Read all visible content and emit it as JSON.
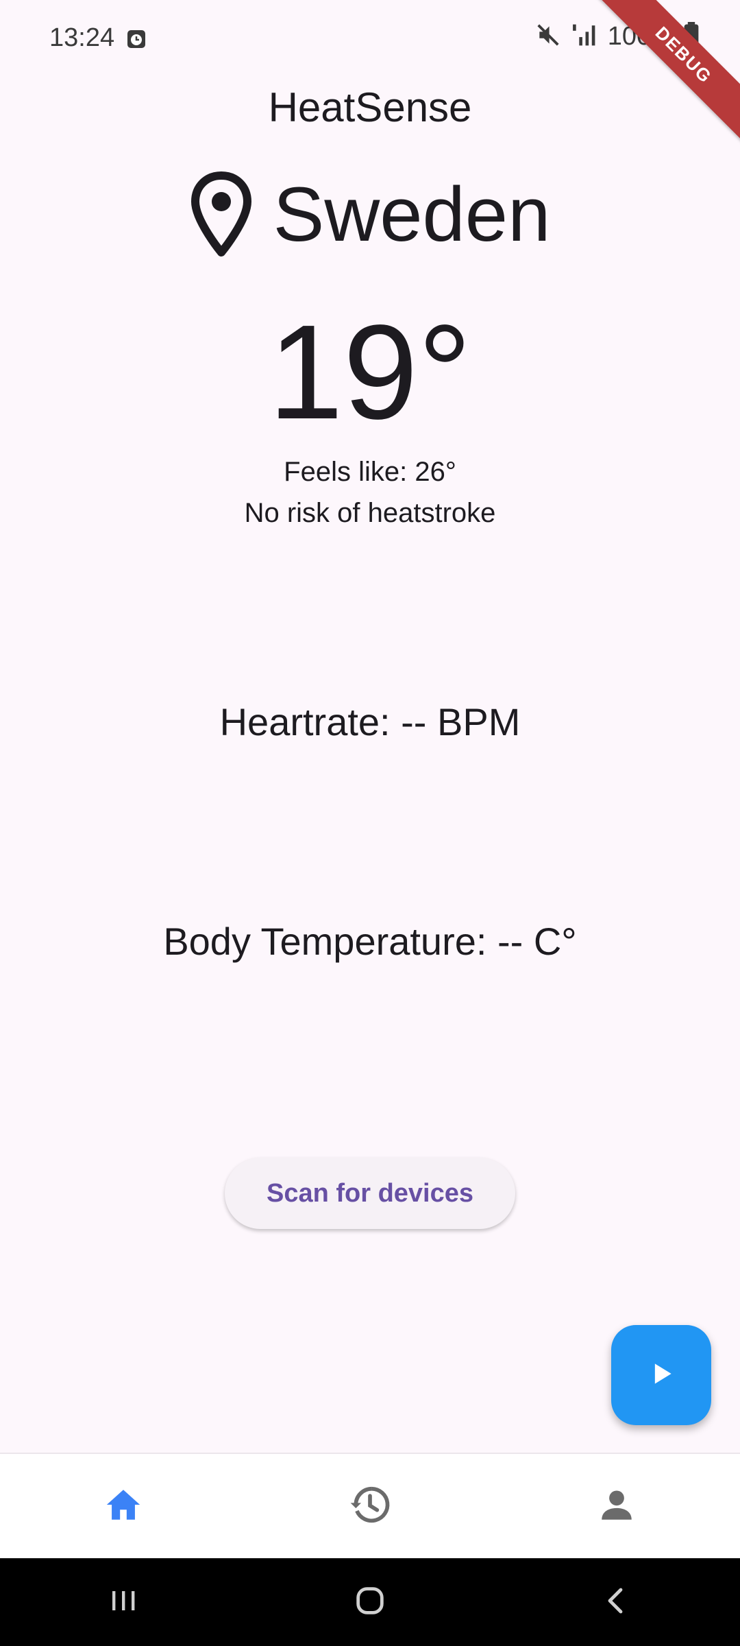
{
  "status_bar": {
    "time": "13:24",
    "battery": "100%",
    "icons": [
      "alarm-icon",
      "mute-icon",
      "signal-icon",
      "battery-icon"
    ]
  },
  "debug_banner": "DEBUG",
  "app": {
    "title": "HeatSense",
    "location": "Sweden",
    "temperature": "19°",
    "feels_like": "Feels like: 26°",
    "risk": "No risk of heatstroke",
    "heartrate": "Heartrate: -- BPM",
    "body_temperature": "Body Temperature: -- C°",
    "scan_button": "Scan for devices"
  },
  "fab": {
    "icon": "play-icon",
    "color": "#2196f3"
  },
  "bottom_nav": {
    "items": [
      {
        "icon": "home-icon",
        "active": true
      },
      {
        "icon": "history-icon",
        "active": false
      },
      {
        "icon": "profile-icon",
        "active": false
      }
    ],
    "active_color": "#3b82f6",
    "inactive_color": "#6b6b6b"
  },
  "system_nav": {
    "icons": [
      "recent-apps-icon",
      "home-circle-icon",
      "back-icon"
    ]
  },
  "colors": {
    "background": "#fdf7fc",
    "accent": "#6750a4",
    "fab": "#2196f3",
    "debug": "#b73a3a"
  }
}
